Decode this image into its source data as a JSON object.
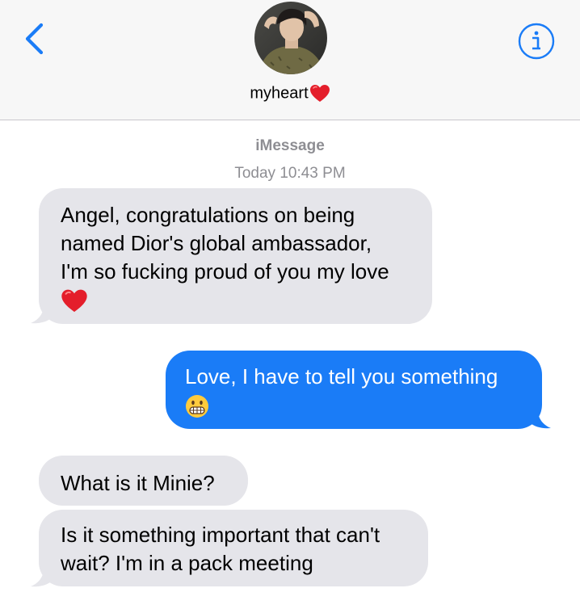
{
  "header": {
    "back_icon": "chevron-left-icon",
    "info_icon": "info-circle-icon",
    "contact_name": "myheart",
    "contact_emoji": "red-heart-emoji"
  },
  "thread": {
    "service": "iMessage",
    "timestamp": "Today 10:43 PM"
  },
  "messages": [
    {
      "direction": "incoming",
      "lines": [
        "Angel, congratulations on being",
        "named Dior's global ambassador,",
        "I'm so fucking proud of you my love"
      ],
      "emoji": "red-heart-emoji"
    },
    {
      "direction": "outgoing",
      "lines": [
        "Love, I have to tell you something"
      ],
      "emoji": "grimacing-face-emoji"
    },
    {
      "direction": "incoming",
      "lines": [
        "What is it Minie?"
      ]
    },
    {
      "direction": "incoming",
      "lines": [
        "Is it something important that can't",
        "wait? I'm in a pack meeting"
      ]
    }
  ],
  "colors": {
    "accent": "#1a7cf7",
    "incoming_bubble": "#e5e5ea",
    "header_bg": "#f7f7f7",
    "meta_text": "#8e8e93"
  }
}
